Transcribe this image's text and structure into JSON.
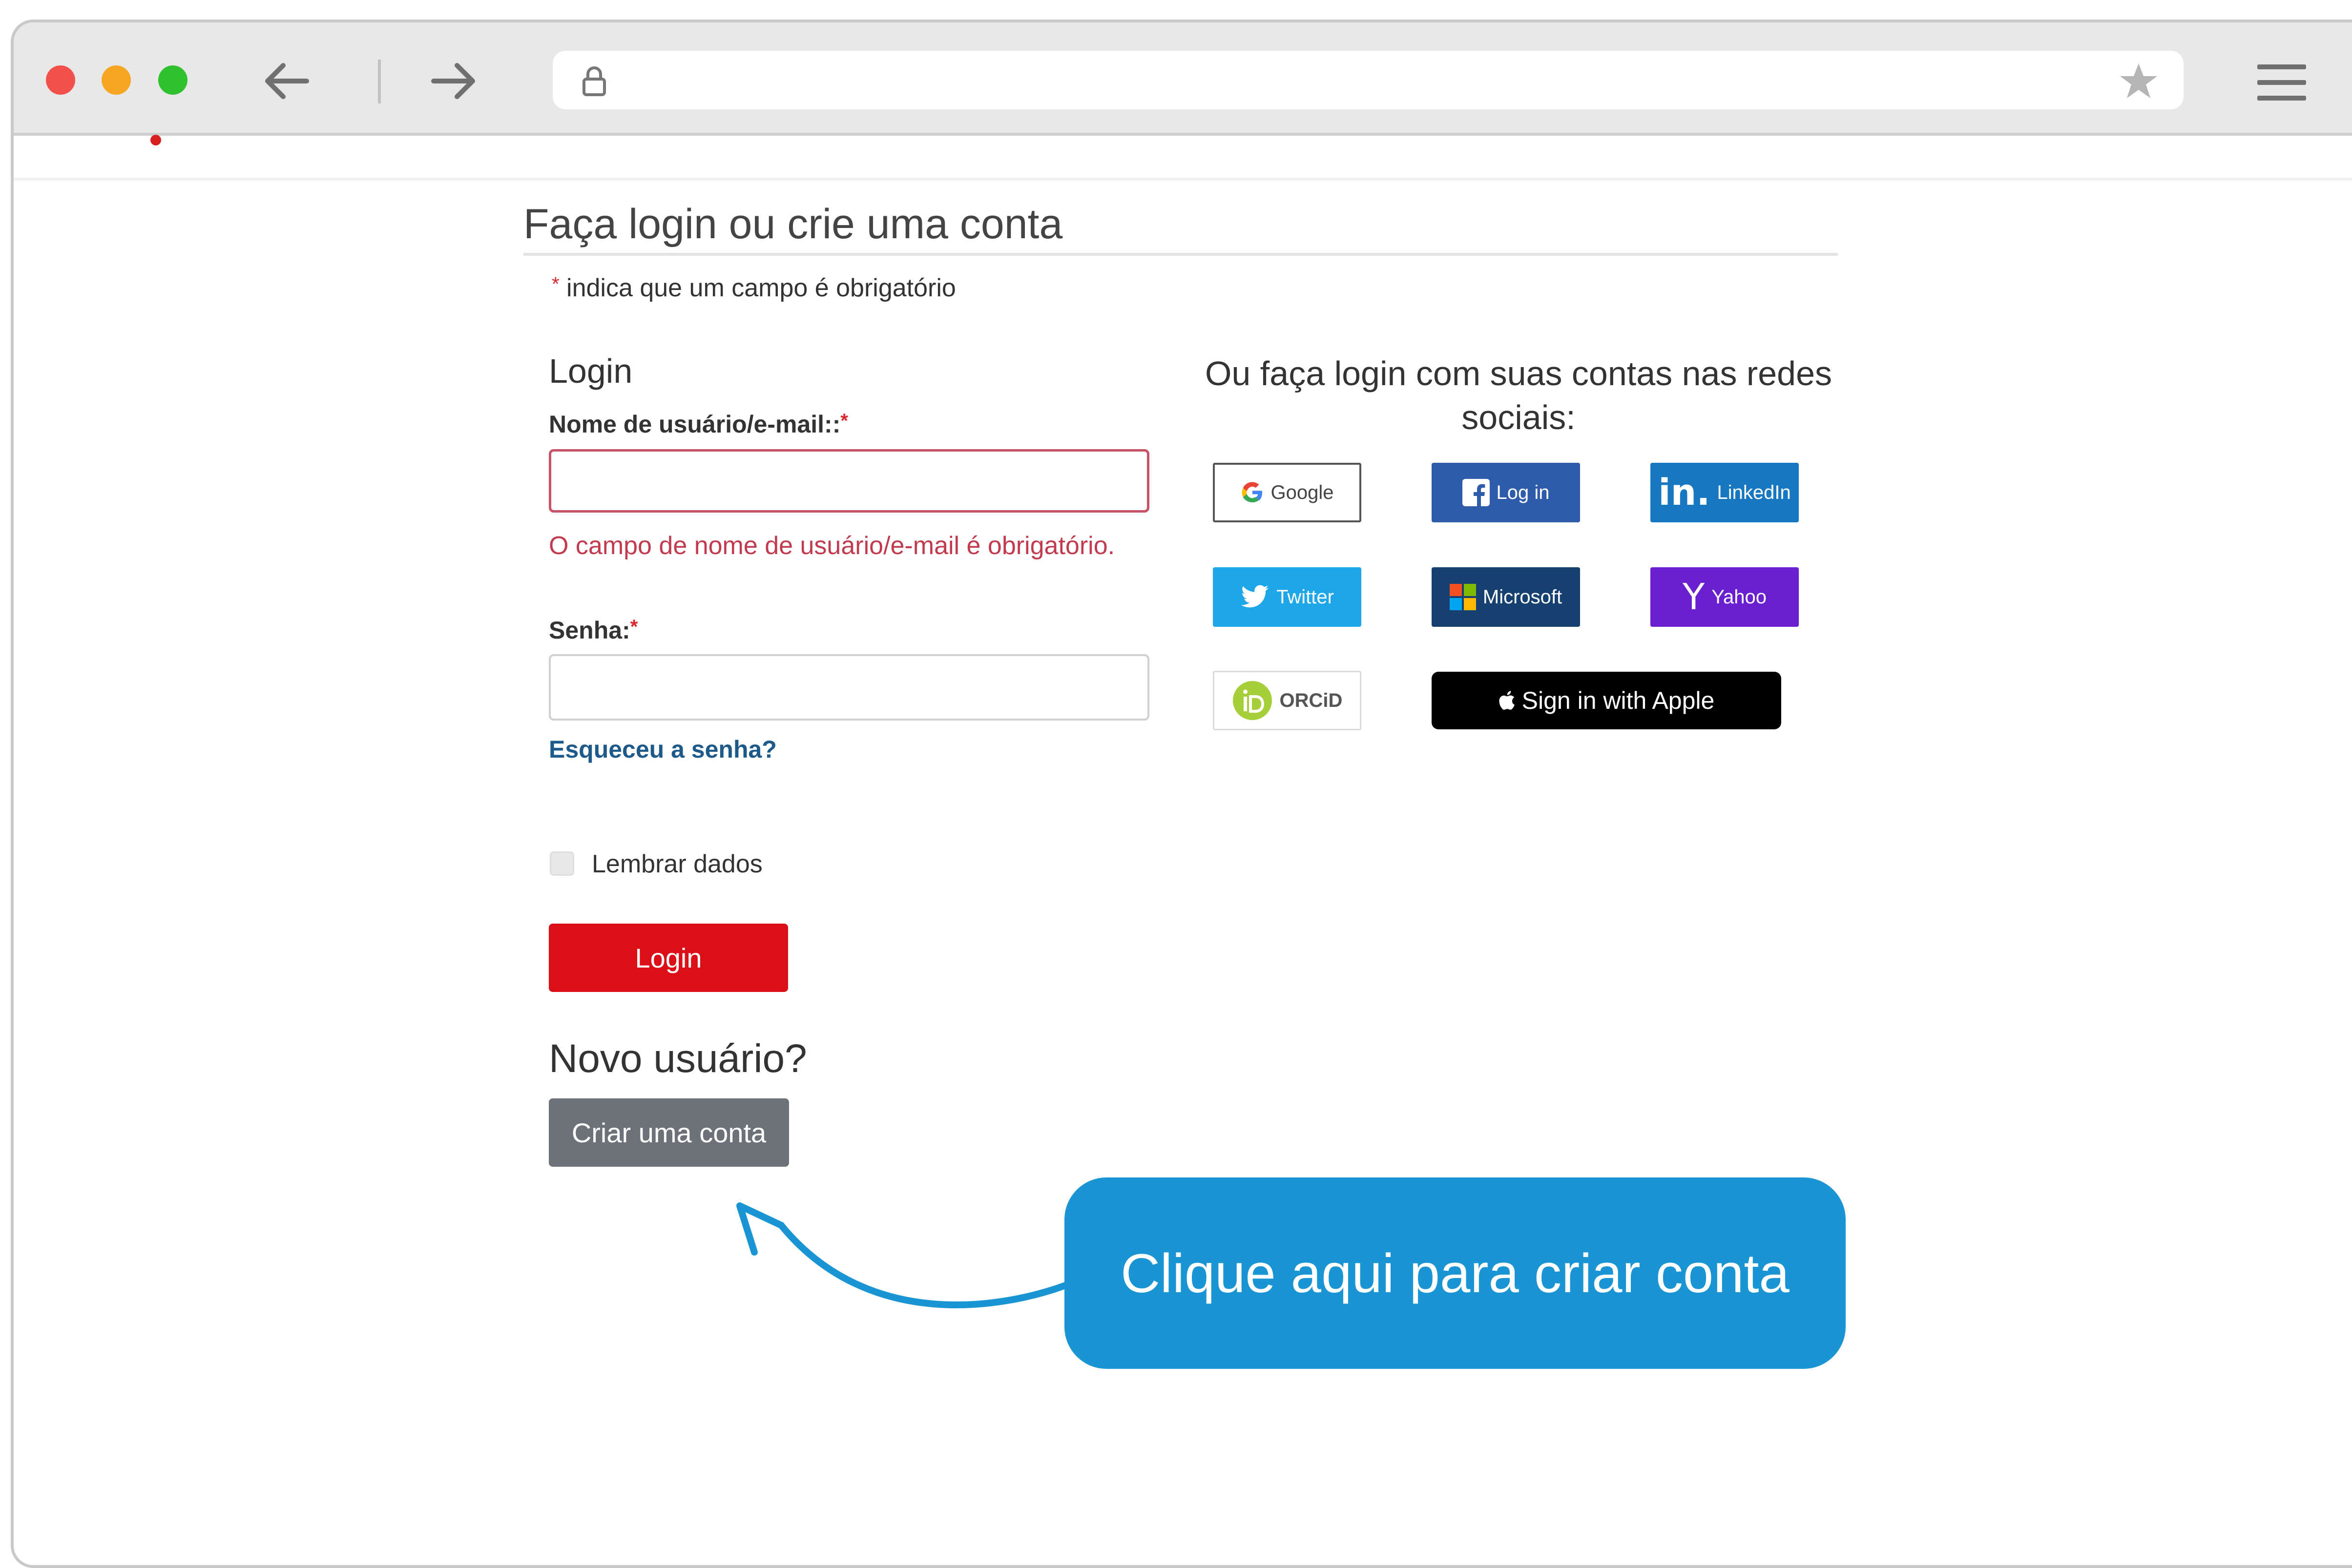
{
  "browser": {
    "address_value": ""
  },
  "page": {
    "heading": "Faça login ou crie uma conta",
    "required_note_star": "*",
    "required_note": "indica que um campo é obrigatório"
  },
  "login": {
    "title": "Login",
    "username_label": "Nome de usuário/e-mail::",
    "username_required": "*",
    "username_value": "",
    "username_error": "O campo de nome de usuário/e-mail é obrigatório.",
    "password_label": "Senha:",
    "password_required": "*",
    "password_value": "",
    "forgot_link": "Esqueceu a senha?",
    "remember_label": "Lembrar dados",
    "remember_checked": false,
    "submit_label": "Login"
  },
  "new_user": {
    "title": "Novo usuário?",
    "create_label": "Criar uma conta"
  },
  "social": {
    "title": "Ou faça login com suas contas nas redes sociais:",
    "buttons": {
      "google": {
        "label": "Google",
        "icon": "google-icon"
      },
      "facebook": {
        "label": "Log in",
        "icon": "facebook-icon",
        "color": "#2e5cab"
      },
      "linkedin": {
        "label": "LinkedIn",
        "icon": "linkedin-icon",
        "color": "#1877c1"
      },
      "twitter": {
        "label": "Twitter",
        "icon": "twitter-icon",
        "color": "#1ea7e8"
      },
      "microsoft": {
        "label": "Microsoft",
        "icon": "microsoft-icon",
        "color": "#16406f"
      },
      "yahoo": {
        "label": "Yahoo",
        "icon": "yahoo-icon",
        "color": "#6a1fd1"
      },
      "orcid": {
        "label": "ORCiD",
        "icon": "orcid-icon"
      },
      "apple": {
        "label": "Sign in with Apple",
        "icon": "apple-icon",
        "color": "#000000"
      }
    }
  },
  "callout": {
    "text": "Clique aqui para criar conta",
    "color": "#1a95d4"
  },
  "colors": {
    "primary_red": "#db0f17",
    "link_blue": "#1d5a8a",
    "error_red": "#c23a4e"
  }
}
